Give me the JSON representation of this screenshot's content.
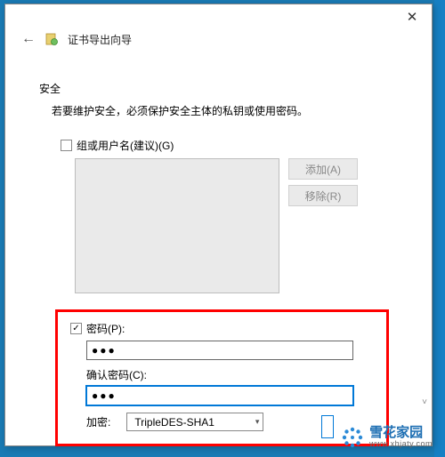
{
  "titlebar": {
    "close_glyph": "✕"
  },
  "header": {
    "back_glyph": "←",
    "wizard_title": "证书导出向导"
  },
  "security": {
    "label": "安全",
    "desc": "若要维护安全，必须保护安全主体的私钥或使用密码。"
  },
  "group_users": {
    "checkbox_label": "组或用户名(建议)(G)"
  },
  "side_buttons": {
    "add": "添加(A)",
    "remove": "移除(R)"
  },
  "password_section": {
    "checkbox_label": "密码(P):",
    "password_value": "●●●",
    "confirm_label": "确认密码(C):",
    "confirm_value": "●●●"
  },
  "encryption": {
    "label": "加密:",
    "selected": "TripleDES-SHA1"
  },
  "watermark": {
    "main": "雪花家园",
    "sub": "www.xhjaty.com"
  }
}
